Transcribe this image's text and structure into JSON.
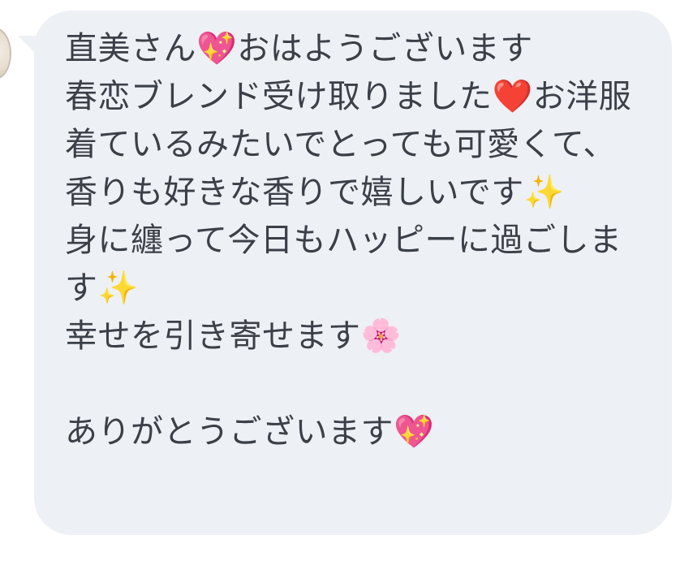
{
  "chat": {
    "message_text": "直美さん💖おはようございます\n春恋ブレンド受け取りました❤️お洋服着ているみたいでとっても可愛くて、香りも好きな香りで嬉しいです✨\n身に纏って今日もハッピーに過ごします✨\n幸せを引き寄せます🌸\n\nありがとうございます💖"
  },
  "colors": {
    "bubble_background": "#edf0f4",
    "text": "#3b4048",
    "page_background": "#ffffff"
  }
}
